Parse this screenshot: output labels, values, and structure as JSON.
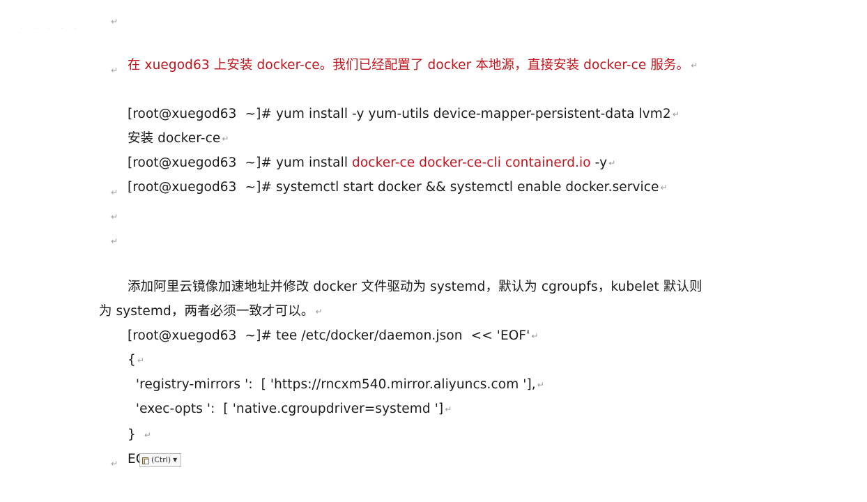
{
  "document": {
    "line_heading": {
      "parts": [
        {
          "text": "在 xuegod63 上安装 docker-ce。我们已经配置了 docker 本地源，直接安装 docker-ce 服务。",
          "color": "#c0141c"
        }
      ]
    },
    "cmd_yum_utils": "[root@xuegod63  ~]# yum install -y yum-utils device-mapper-persistent-data lvm2",
    "label_install": "安装 docker-ce",
    "cmd_install_prefix": "[root@xuegod63  ~]# yum install ",
    "cmd_install_packages": "docker-ce docker-ce-cli containerd.io",
    "cmd_install_suffix": " -y",
    "cmd_start": "[root@xuegod63  ~]# systemctl start docker && systemctl enable docker.service",
    "desc_line1": "添加阿里云镜像加速地址并修改 docker 文件驱动为 systemd，默认为 cgroupfs，kubelet 默认则",
    "desc_line2": "为 systemd，两者必须一致才可以。",
    "cmd_tee": "[root@xuegod63  ~]# tee /etc/docker/daemon.json  << 'EOF'",
    "json_open": "{",
    "json_mirrors": "  'registry-mirrors ':  [ 'https://rncxm540.mirror.aliyuncs.com '],",
    "json_exec": "  'exec-opts ':  [ 'native.cgroupdriver=systemd ']",
    "json_close": "}",
    "eof": "EOF",
    "paste_options_label": "(Ctrl)",
    "paragraph_mark": "↵",
    "accent_color": "#c0141c"
  }
}
